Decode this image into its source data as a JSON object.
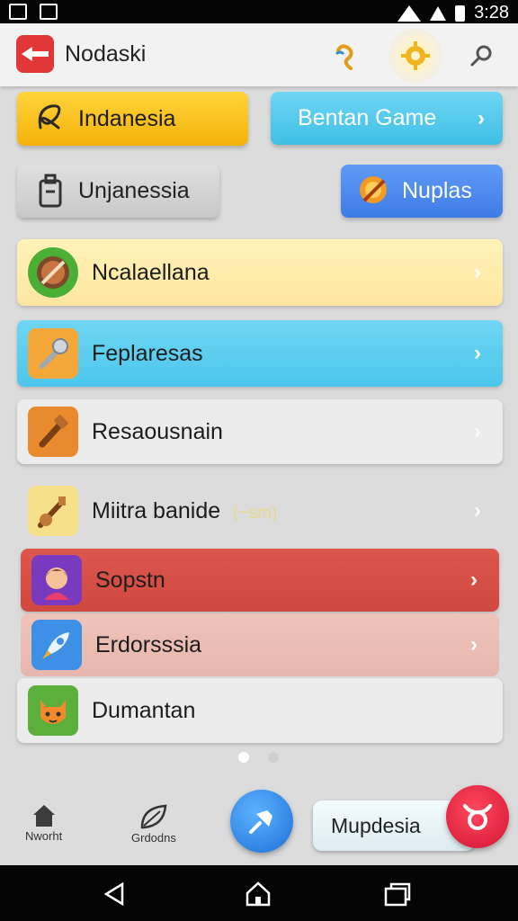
{
  "status_bar": {
    "time": "3:28"
  },
  "app_bar": {
    "title": "Nodaski"
  },
  "grid": {
    "b1": "Indanesia",
    "b2": "Bentan Game",
    "b3": "Unjanessia",
    "b4": "Nuplas"
  },
  "list": [
    {
      "label": "Ncalaellana"
    },
    {
      "label": "Feplaresas"
    },
    {
      "label": "Resaousnain"
    },
    {
      "label": "Miitra banide",
      "note": "(~sm)"
    },
    {
      "label": "Sopstn"
    },
    {
      "label": "Erdorsssia"
    },
    {
      "label": "Dumantan"
    }
  ],
  "bottom_nav": {
    "home_label": "Nworht",
    "second_label": "Grdodns",
    "pill_label": "Mupdesia"
  },
  "colors": {
    "accent_yellow": "#f6c21c",
    "accent_blue": "#4cc7ec",
    "accent_red": "#d84c45",
    "list_yellow": "#fdeaa0",
    "list_pink": "#e9b9b0"
  }
}
